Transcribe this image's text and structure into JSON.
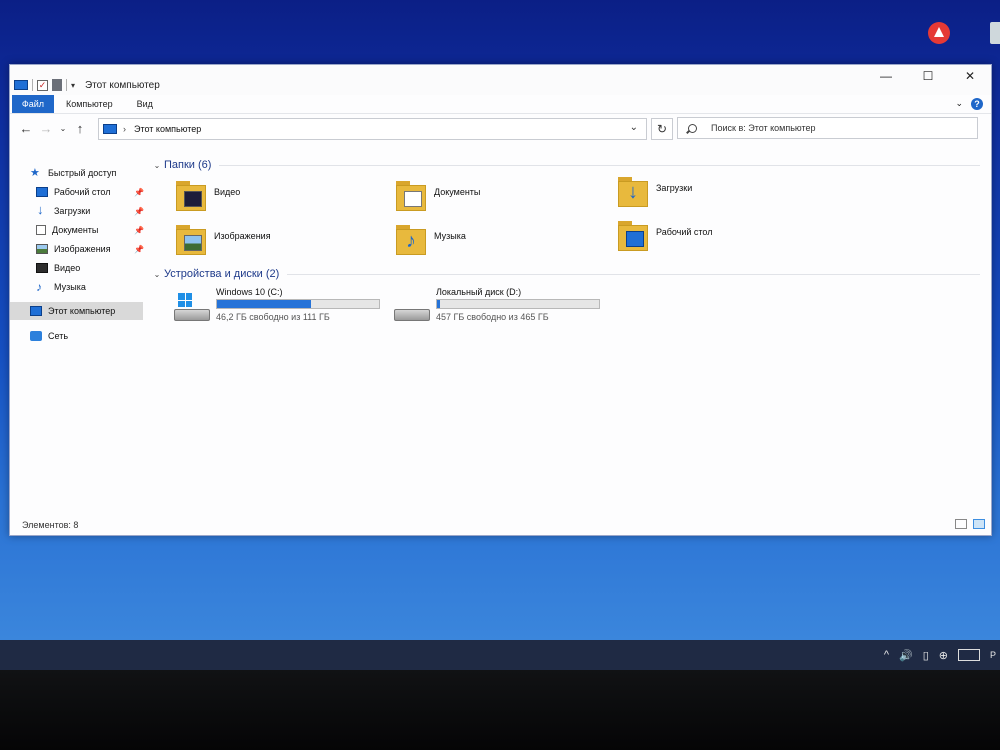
{
  "window": {
    "title": "Этот компьютер",
    "minimize": "—",
    "maximize": "☐",
    "close": "✕"
  },
  "ribbon": {
    "tabs": [
      "Файл",
      "Компьютер",
      "Вид"
    ],
    "expand": "⌄",
    "help": "?"
  },
  "nav": {
    "back": "←",
    "forward": "→",
    "recent": "⌄",
    "up": "↑",
    "address_chevron": "›",
    "address": "Этот компьютер",
    "address_dropdown": "⌄",
    "refresh": "↻",
    "search_placeholder": "Поиск в: Этот компьютер"
  },
  "sidebar": {
    "items": [
      {
        "label": "Быстрый доступ",
        "icon": "star-icon",
        "pinned": false
      },
      {
        "label": "Рабочий стол",
        "icon": "desktop-icon",
        "pinned": true
      },
      {
        "label": "Загрузки",
        "icon": "downloads-icon",
        "pinned": true
      },
      {
        "label": "Документы",
        "icon": "documents-icon",
        "pinned": true
      },
      {
        "label": "Изображения",
        "icon": "pictures-icon",
        "pinned": true
      },
      {
        "label": "Видео",
        "icon": "videos-icon",
        "pinned": false
      },
      {
        "label": "Музыка",
        "icon": "music-icon",
        "pinned": false
      },
      {
        "label": "Этот компьютер",
        "icon": "computer-icon",
        "selected": true
      },
      {
        "label": "Сеть",
        "icon": "network-icon",
        "pinned": false
      }
    ],
    "pin_glyph": "📌"
  },
  "main": {
    "folders_header": "Папки (6)",
    "folders": [
      {
        "label": "Видео",
        "icon": "videos-folder-icon"
      },
      {
        "label": "Документы",
        "icon": "documents-folder-icon"
      },
      {
        "label": "Загрузки",
        "icon": "downloads-folder-icon"
      },
      {
        "label": "Изображения",
        "icon": "pictures-folder-icon"
      },
      {
        "label": "Музыка",
        "icon": "music-folder-icon"
      },
      {
        "label": "Рабочий стол",
        "icon": "desktop-folder-icon"
      }
    ],
    "drives_header": "Устройства и диски (2)",
    "drives": [
      {
        "label": "Windows 10 (C:)",
        "free": "46,2 ГБ свободно из 111 ГБ",
        "used_fraction": 0.58,
        "icon": "system-drive-icon"
      },
      {
        "label": "Локальный диск (D:)",
        "free": "457 ГБ свободно из 465 ГБ",
        "used_fraction": 0.02,
        "icon": "local-drive-icon"
      }
    ]
  },
  "status": {
    "items_count": "Элементов: 8"
  },
  "taskbar": {
    "tray_lang": "Р",
    "tray_icons": [
      "chevron-up-icon",
      "volume-icon",
      "usb-icon",
      "network-globe-icon",
      "keyboard-icon"
    ]
  },
  "colors": {
    "accent": "#1f67c9",
    "progress": "#2673d8",
    "folder": "#e8b93d"
  }
}
